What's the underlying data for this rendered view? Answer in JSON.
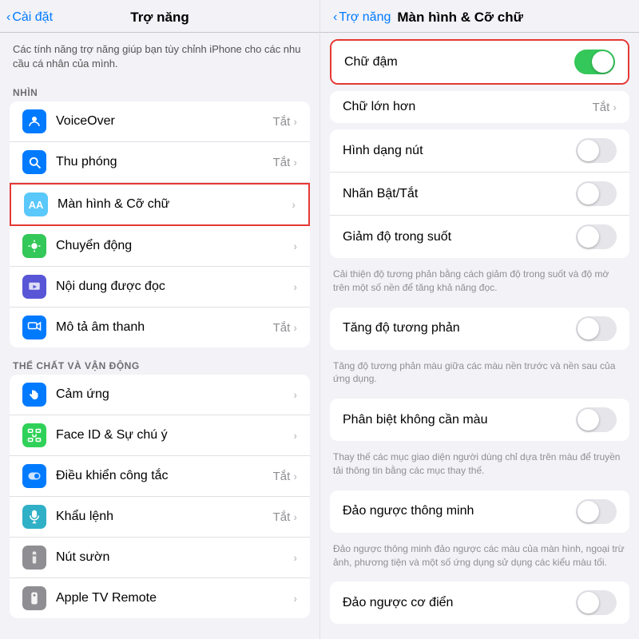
{
  "left": {
    "nav_back": "Cài đặt",
    "nav_title": "Trợ năng",
    "intro": "Các tính năng trợ năng giúp bạn tùy chỉnh iPhone cho các nhu cầu cá nhân của mình.",
    "section_vision": "NHÌN",
    "section_physical": "THỂ CHẤT VÀ VẬN ĐỘNG",
    "vision_items": [
      {
        "id": "voiceover",
        "label": "VoiceOver",
        "value": "Tắt",
        "has_chevron": true,
        "icon_color": "blue"
      },
      {
        "id": "zoom",
        "label": "Thu phóng",
        "value": "Tắt",
        "has_chevron": true,
        "icon_color": "blue"
      },
      {
        "id": "display",
        "label": "Màn hình & Cỡ chữ",
        "value": "",
        "has_chevron": true,
        "icon_color": "blue2",
        "highlighted": true
      },
      {
        "id": "motion",
        "label": "Chuyển động",
        "value": "",
        "has_chevron": true,
        "icon_color": "green"
      },
      {
        "id": "spoken",
        "label": "Nội dung được đọc",
        "value": "",
        "has_chevron": true,
        "icon_color": "indigo"
      },
      {
        "id": "audiodesc",
        "label": "Mô tả âm thanh",
        "value": "Tắt",
        "has_chevron": true,
        "icon_color": "blue3"
      }
    ],
    "physical_items": [
      {
        "id": "touch",
        "label": "Cảm ứng",
        "value": "",
        "has_chevron": true,
        "icon_color": "blue4"
      },
      {
        "id": "faceid",
        "label": "Face ID & Sự chú ý",
        "value": "",
        "has_chevron": true,
        "icon_color": "green2"
      },
      {
        "id": "switch",
        "label": "Điều khiển công tắc",
        "value": "Tắt",
        "has_chevron": true,
        "icon_color": "blue"
      },
      {
        "id": "voice",
        "label": "Khẩu lệnh",
        "value": "Tắt",
        "has_chevron": true,
        "icon_color": "teal"
      },
      {
        "id": "side",
        "label": "Nút sườn",
        "value": "",
        "has_chevron": true,
        "icon_color": "gray"
      },
      {
        "id": "appletv",
        "label": "Apple TV Remote",
        "value": "",
        "has_chevron": true,
        "icon_color": "gray"
      }
    ]
  },
  "right": {
    "nav_back": "Trợ năng",
    "nav_title": "Màn hình & Cỡ chữ",
    "items": [
      {
        "id": "bold-text",
        "label": "Chữ đậm",
        "type": "toggle",
        "value": true,
        "highlighted": true
      },
      {
        "id": "larger-text",
        "label": "Chữ lớn hơn",
        "value": "Tắt",
        "type": "value",
        "has_chevron": true
      },
      {
        "id": "button-shapes",
        "label": "Hình dạng nút",
        "type": "toggle",
        "value": false
      },
      {
        "id": "on-off-labels",
        "label": "Nhãn Bật/Tắt",
        "type": "toggle",
        "value": false
      },
      {
        "id": "reduce-transparency",
        "label": "Giảm độ trong suốt",
        "type": "toggle",
        "value": false,
        "description": "Cải thiện độ tương phản bằng cách giảm độ trong suốt và độ mờ trên một số nền để tăng khả năng đọc."
      },
      {
        "id": "increase-contrast",
        "label": "Tăng độ tương phản",
        "type": "toggle",
        "value": false,
        "description": "Tăng độ tương phản màu giữa các màu nền trước và nền sau của ứng dụng."
      },
      {
        "id": "differentiate-colors",
        "label": "Phân biệt không cần màu",
        "type": "toggle",
        "value": false,
        "description": "Thay thế các mục giao diện người dùng chỉ dựa trên màu để truyền tải thông tin bằng các mục thay thế."
      },
      {
        "id": "smart-invert",
        "label": "Đảo ngược thông minh",
        "type": "toggle",
        "value": false,
        "description": "Đảo ngược thông minh đảo ngược các màu của màn hình, ngoại trừ ảnh, phương tiện và một số ứng dụng sử dụng các kiểu màu tối."
      },
      {
        "id": "classic-invert",
        "label": "Đảo ngược cơ điển",
        "type": "toggle",
        "value": false
      }
    ]
  }
}
